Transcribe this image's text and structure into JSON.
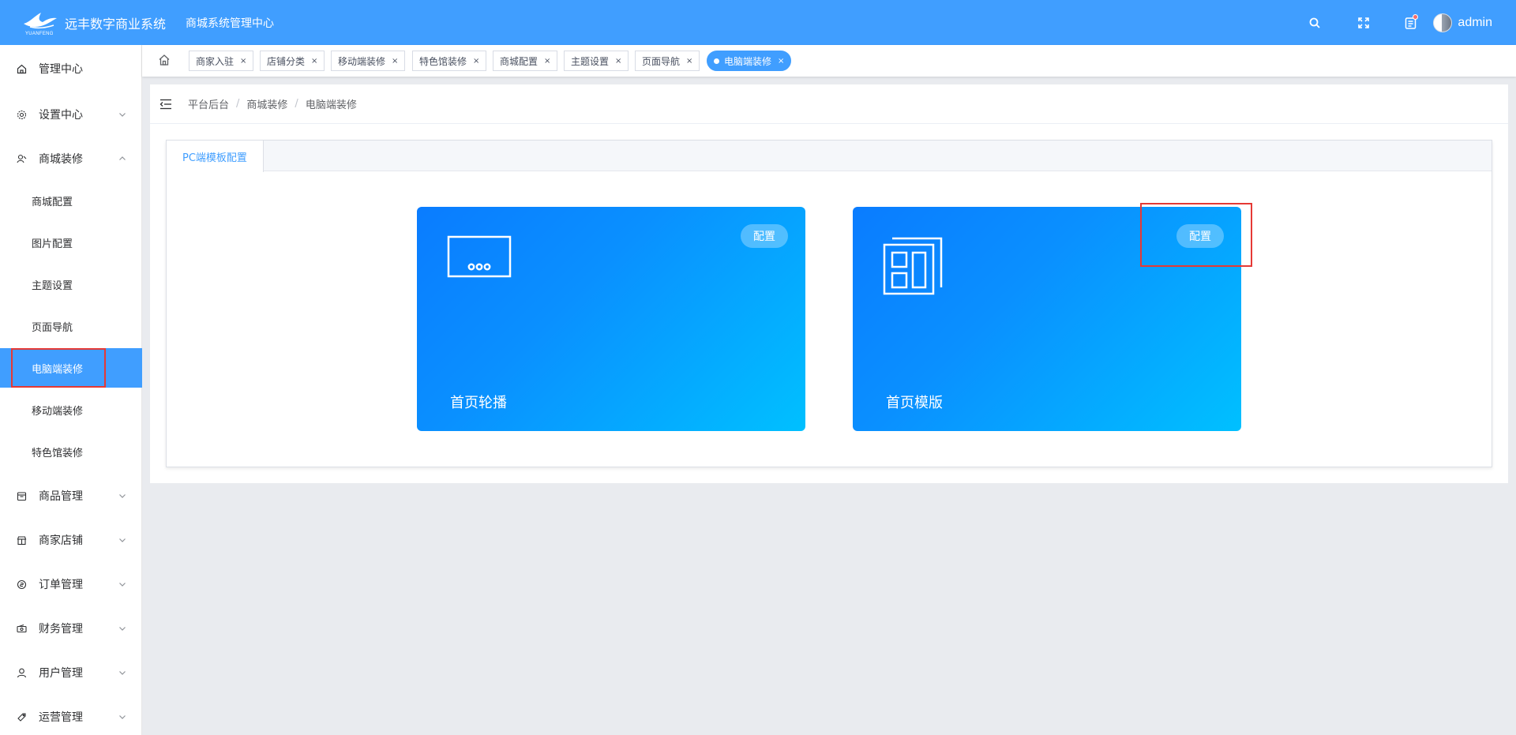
{
  "header": {
    "brand_name": "远丰数字商业系统",
    "logo_subtext": "YUANFENG",
    "system_name": "商城系统管理中心",
    "user_name": "admin",
    "icons": [
      "search-icon",
      "fullscreen-icon",
      "notification-icon"
    ]
  },
  "sidebar": {
    "items": [
      {
        "label": "管理中心",
        "icon": "home-icon"
      },
      {
        "label": "设置中心",
        "icon": "gear-icon",
        "expandable": true
      },
      {
        "label": "商城装修",
        "icon": "decoration-icon",
        "expanded": true,
        "children": [
          "商城配置",
          "图片配置",
          "主题设置",
          "页面导航",
          "电脑端装修",
          "移动端装修",
          "特色馆装修"
        ]
      },
      {
        "label": "商品管理",
        "icon": "goods-icon",
        "expandable": true
      },
      {
        "label": "商家店铺",
        "icon": "store-icon",
        "expandable": true
      },
      {
        "label": "订单管理",
        "icon": "order-icon",
        "expandable": true
      },
      {
        "label": "财务管理",
        "icon": "finance-icon",
        "expandable": true
      },
      {
        "label": "用户管理",
        "icon": "user-icon",
        "expandable": true
      },
      {
        "label": "运营管理",
        "icon": "operation-icon",
        "expandable": true
      }
    ],
    "active_child": "电脑端装修"
  },
  "tags": [
    {
      "label": "商家入驻"
    },
    {
      "label": "店铺分类"
    },
    {
      "label": "移动端装修"
    },
    {
      "label": "特色馆装修"
    },
    {
      "label": "商城配置"
    },
    {
      "label": "主题设置"
    },
    {
      "label": "页面导航"
    },
    {
      "label": "电脑端装修",
      "active": true
    }
  ],
  "tag_close": "×",
  "breadcrumb": [
    "平台后台",
    "商城装修",
    "电脑端装修"
  ],
  "breadcrumb_sep": "/",
  "tab": {
    "label": "PC端模板配置"
  },
  "cards": [
    {
      "title": "首页轮播",
      "button": "配置",
      "icon": "banner-carousel-icon"
    },
    {
      "title": "首页模版",
      "button": "配置",
      "icon": "template-layout-icon"
    }
  ],
  "colors": {
    "primary": "#409eff",
    "card_gradient_start": "#0a7cff",
    "card_gradient_end": "#00c0ff",
    "highlight_box": "#e53935"
  }
}
